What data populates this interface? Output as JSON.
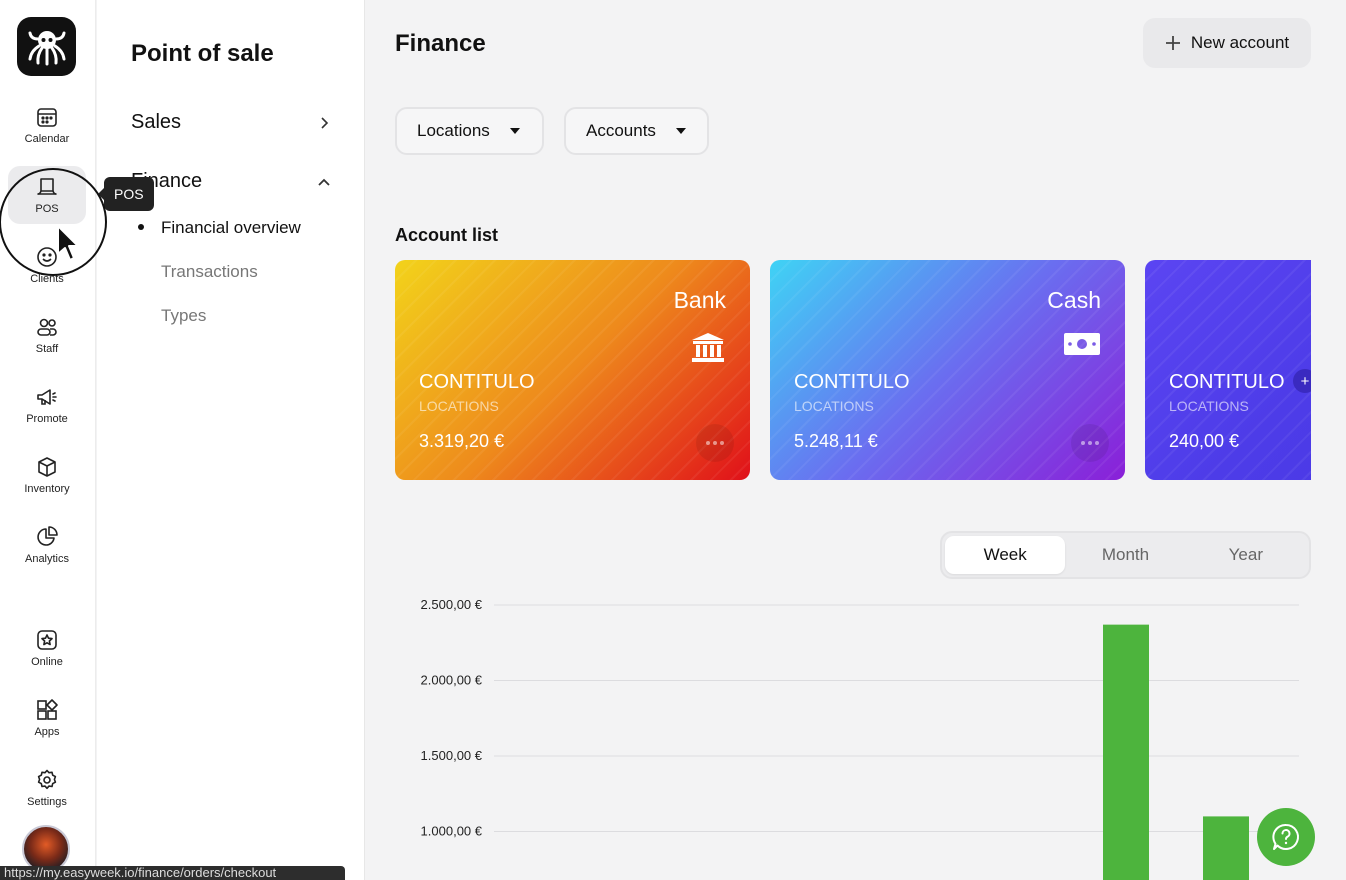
{
  "rail": {
    "items": [
      {
        "label": "Calendar",
        "icon": "calendar-icon"
      },
      {
        "label": "POS",
        "icon": "pos-icon",
        "active": true
      },
      {
        "label": "Clients",
        "icon": "smile-icon"
      },
      {
        "label": "Staff",
        "icon": "people-icon"
      },
      {
        "label": "Promote",
        "icon": "megaphone-icon"
      },
      {
        "label": "Inventory",
        "icon": "box-icon"
      },
      {
        "label": "Analytics",
        "icon": "pie-chart-icon"
      },
      {
        "label": "Online",
        "icon": "star-badge-icon"
      },
      {
        "label": "Apps",
        "icon": "apps-icon"
      },
      {
        "label": "Settings",
        "icon": "gear-icon"
      }
    ],
    "tooltip": "POS",
    "status_url": "https://my.easyweek.io/finance/orders/checkout"
  },
  "subnav": {
    "title": "Point of sale",
    "sections": [
      {
        "label": "Sales",
        "expanded": false
      },
      {
        "label": "Finance",
        "expanded": true
      }
    ],
    "finance_items": [
      {
        "label": "Financial overview",
        "active": true
      },
      {
        "label": "Transactions"
      },
      {
        "label": "Types"
      }
    ]
  },
  "main": {
    "title": "Finance",
    "new_account_label": "New account",
    "filters": [
      "Locations",
      "Accounts"
    ],
    "account_list_title": "Account list",
    "accounts": [
      {
        "type": "Bank",
        "name": "CONTITULO",
        "subtitle": "LOCATIONS",
        "amount": "3.319,20 €",
        "gradient": [
          "#f2d31b",
          "#ee8a1c",
          "#e0101a"
        ]
      },
      {
        "type": "Cash",
        "name": "CONTITULO",
        "subtitle": "LOCATIONS",
        "amount": "5.248,11 €",
        "gradient": [
          "#3fd3f5",
          "#6a6ef0",
          "#8a1fd8"
        ]
      },
      {
        "type": "",
        "name": "CONTITULO",
        "subtitle": "LOCATIONS",
        "amount": "240,00 €",
        "gradient": [
          "#5b45f2",
          "#4d3ce8",
          "#4a37e4"
        ]
      }
    ],
    "periods": [
      "Week",
      "Month",
      "Year"
    ],
    "active_period": "Week"
  },
  "chart_data": {
    "type": "bar",
    "y_ticks": [
      "2.500,00 €",
      "2.000,00 €",
      "1.500,00 €",
      "1.000,00 €"
    ],
    "y_tick_values": [
      2500,
      2000,
      1500,
      1000
    ],
    "values": [
      2370,
      1100
    ],
    "color": "#4db43d"
  },
  "colors": {
    "accent_green": "#4db43d"
  }
}
